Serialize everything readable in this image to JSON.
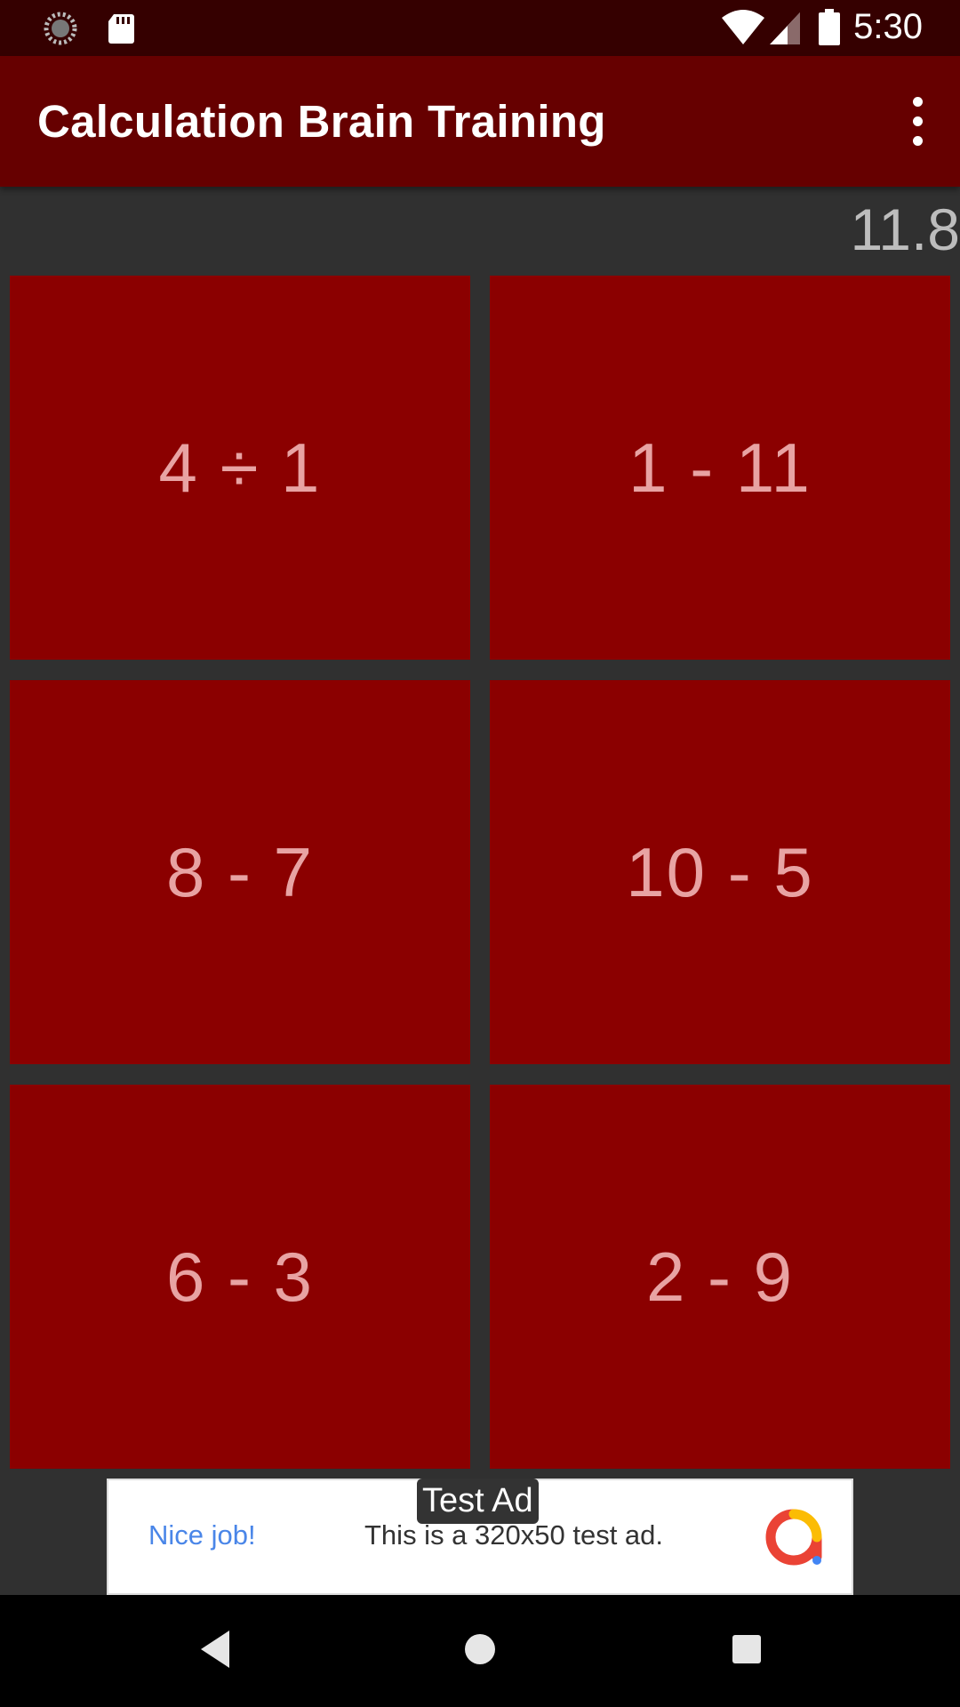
{
  "status_bar": {
    "time": "5:30",
    "icons": [
      "loading-circle-icon",
      "sd-card-icon",
      "wifi-icon",
      "signal-icon",
      "battery-icon"
    ]
  },
  "app_bar": {
    "title": "Calculation Brain Training",
    "menu_icon": "overflow-menu-icon"
  },
  "game": {
    "timer": "11.8",
    "tiles": [
      {
        "label": "4 ÷ 1"
      },
      {
        "label": "1 - 11"
      },
      {
        "label": "8 - 7"
      },
      {
        "label": "10 - 5"
      },
      {
        "label": "6 - 3"
      },
      {
        "label": "2 - 9"
      }
    ]
  },
  "ad": {
    "label": "Test Ad",
    "headline": "Nice job!",
    "body": "This is a 320x50 test ad.",
    "logo_icon": "admob-logo-icon"
  },
  "nav_bar": {
    "buttons": [
      "back-icon",
      "home-icon",
      "recents-icon"
    ]
  },
  "colors": {
    "status_bar": "#350000",
    "app_bar": "#660000",
    "background": "#303030",
    "tile": "#8b0000",
    "tile_text": "#e8a3a3",
    "timer_text": "#bdbdbd"
  }
}
